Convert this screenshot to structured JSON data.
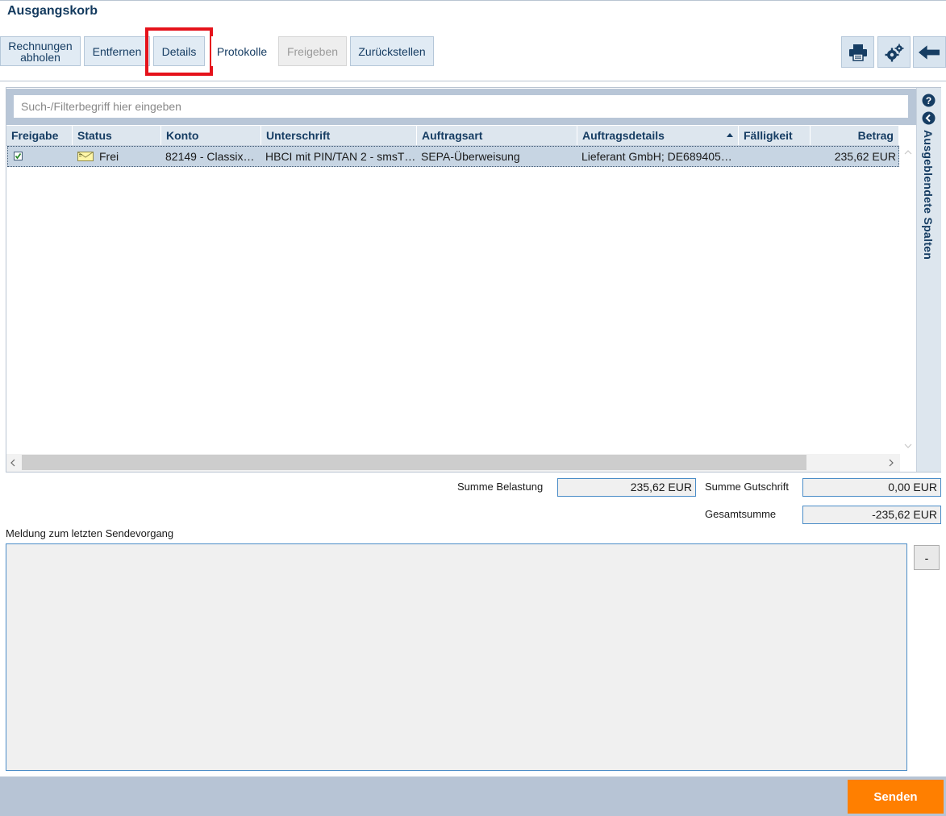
{
  "page": {
    "title": "Ausgangskorb"
  },
  "toolbar": {
    "buttons": {
      "rechnungen_line1": "Rechnungen",
      "rechnungen_line2": "abholen",
      "entfernen": "Entfernen",
      "details": "Details",
      "protokolle": "Protokolle",
      "freigeben": "Freigeben",
      "zurueckstellen": "Zurückstellen"
    },
    "icons": [
      "printer-icon",
      "settings-gears-icon",
      "back-arrow-icon"
    ]
  },
  "search": {
    "placeholder": "Such-/Filterbegriff hier eingeben",
    "value": ""
  },
  "table": {
    "columns": [
      "Freigabe",
      "Status",
      "Konto",
      "Unterschrift",
      "Auftragsart",
      "Auftragsdetails",
      "Fälligkeit",
      "Betrag"
    ],
    "sorted_column": "Auftragsdetails",
    "sort_direction": "ascending",
    "rows": [
      {
        "freigabe_checked": true,
        "status": "Frei",
        "konto": "82149 - Classix…",
        "unterschrift": "HBCI mit PIN/TAN 2 - smsT…",
        "auftragsart": "SEPA-Überweisung",
        "auftragsdetails": "Lieferant GmbH; DE689405…",
        "faelligkeit": "",
        "betrag": "235,62 EUR"
      }
    ]
  },
  "side_panel": {
    "label": "Ausgeblendete Spalten"
  },
  "sums": {
    "belastung_label": "Summe Belastung",
    "belastung_value": "235,62 EUR",
    "gutschrift_label": "Summe Gutschrift",
    "gutschrift_value": "0,00 EUR",
    "gesamt_label": "Gesamtsumme",
    "gesamt_value": "-235,62 EUR"
  },
  "message": {
    "label": "Meldung zum letzten Sendevorgang",
    "text": "",
    "collapse_label": "-"
  },
  "footer": {
    "send_label": "Senden"
  },
  "colors": {
    "accent": "#ff7f00",
    "highlight": "#e5121b",
    "header_text": "#163d63"
  }
}
